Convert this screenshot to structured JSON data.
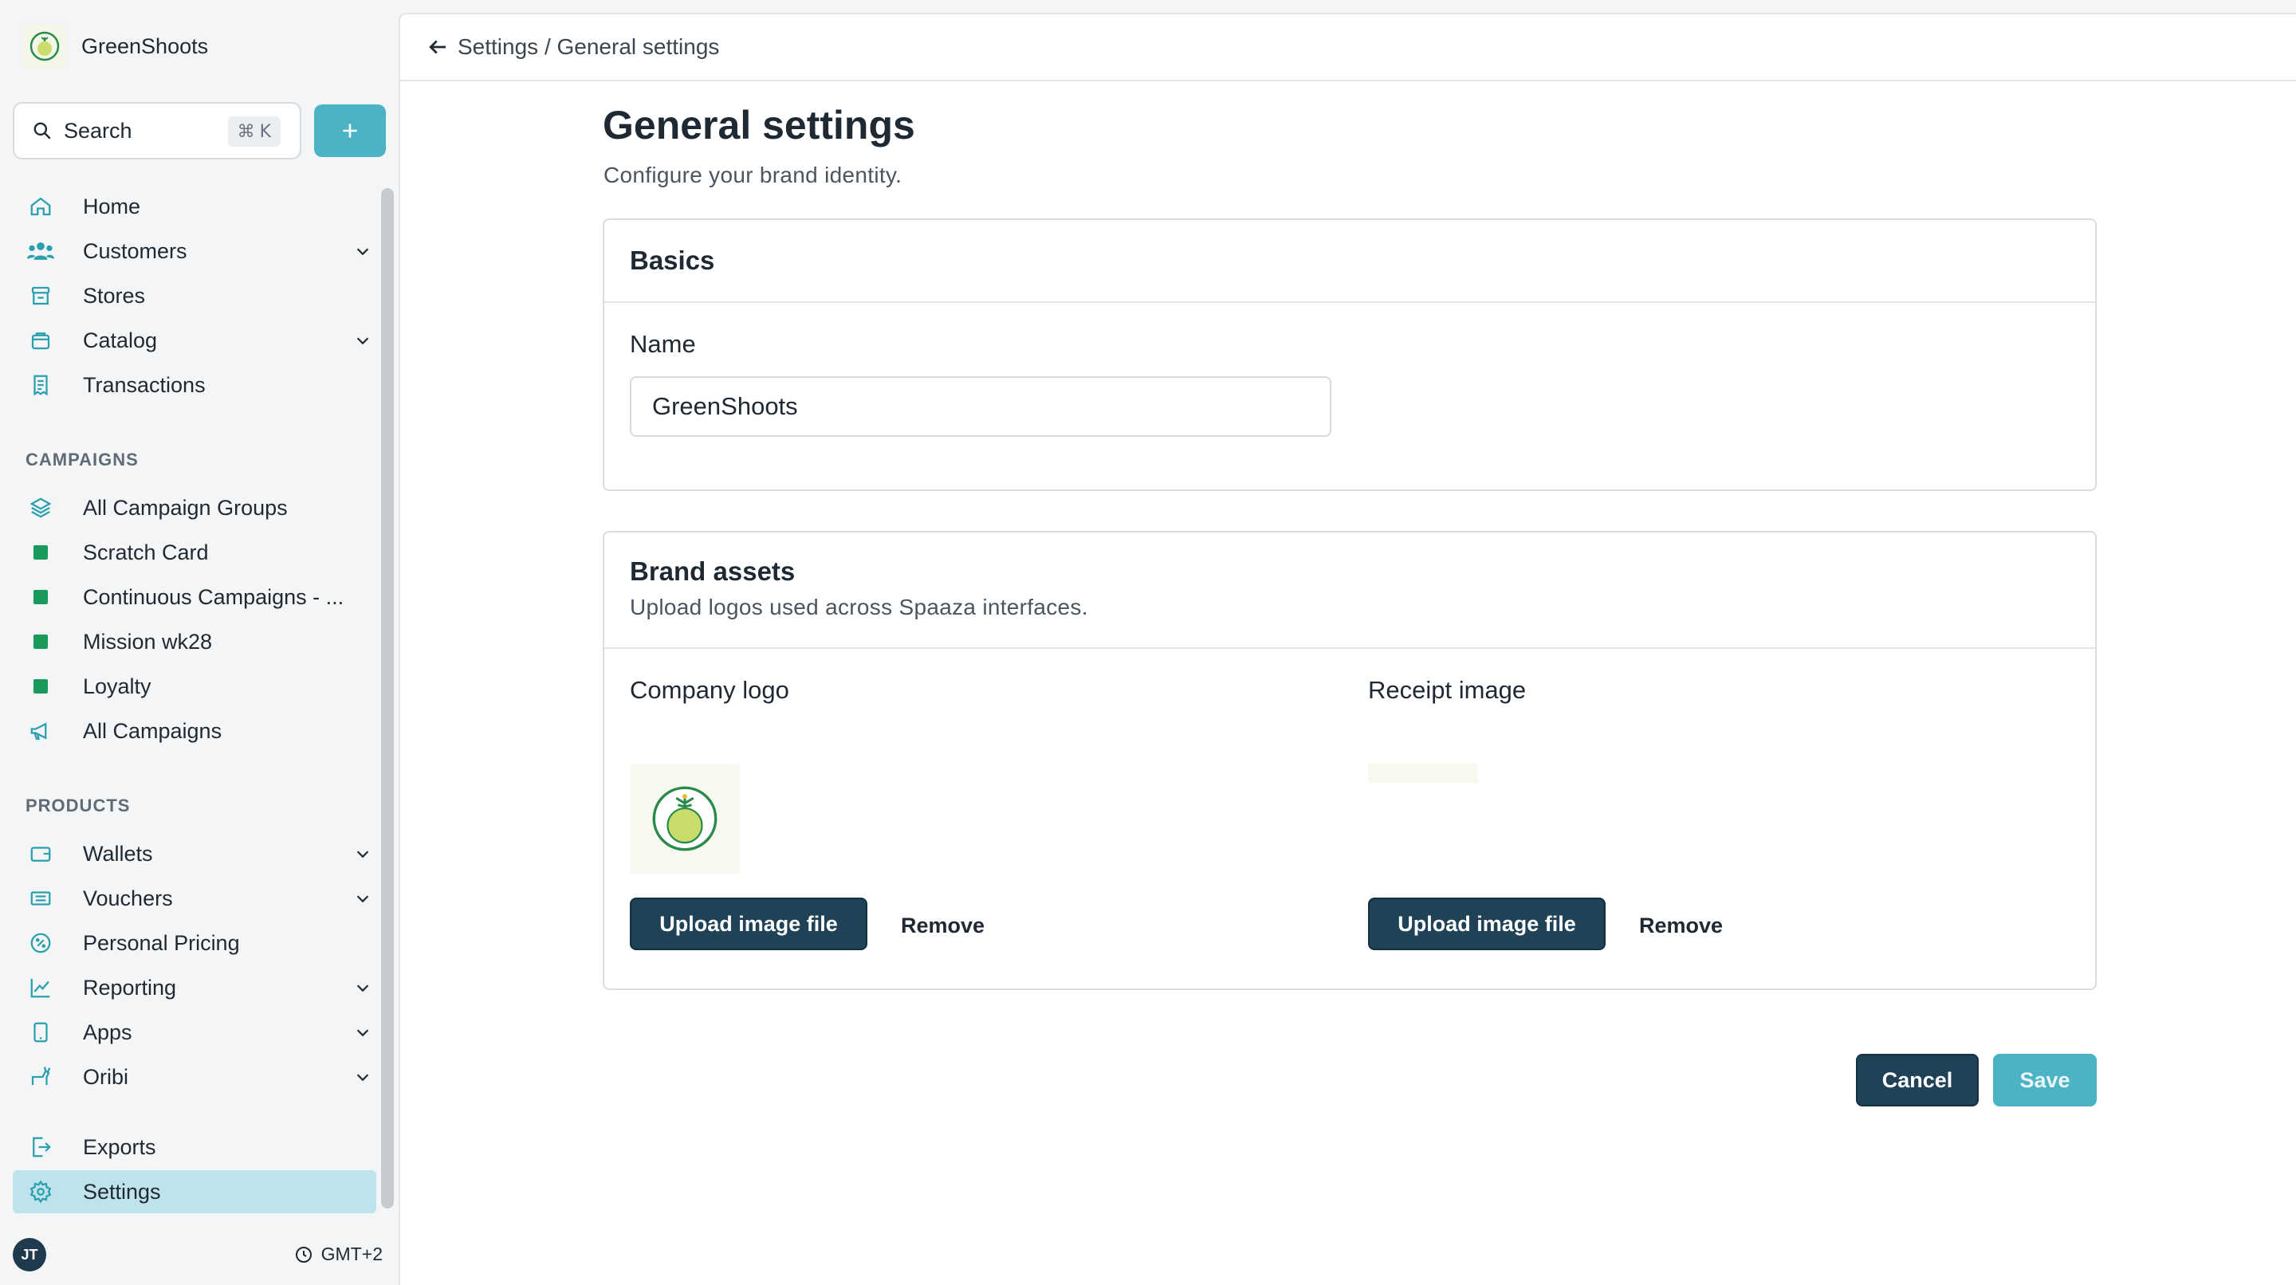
{
  "sidebar": {
    "brand_name": "GreenShoots",
    "search": {
      "label": "Search",
      "shortcut_symbol": "⌘",
      "shortcut_key": "K"
    },
    "main_items": [
      {
        "label": "Home",
        "icon": "home-icon"
      },
      {
        "label": "Customers",
        "icon": "users-icon",
        "expandable": true
      },
      {
        "label": "Stores",
        "icon": "store-icon"
      },
      {
        "label": "Catalog",
        "icon": "bag-icon",
        "expandable": true
      },
      {
        "label": "Transactions",
        "icon": "receipt-icon"
      }
    ],
    "campaigns_heading": "CAMPAIGNS",
    "campaign_items": [
      {
        "label": "All Campaign Groups",
        "icon": "layers-icon"
      },
      {
        "label": "Scratch Card",
        "icon": "green-square-icon"
      },
      {
        "label": "Continuous Campaigns - ...",
        "icon": "green-square-icon"
      },
      {
        "label": "Mission wk28",
        "icon": "green-square-icon"
      },
      {
        "label": "Loyalty",
        "icon": "green-square-icon"
      },
      {
        "label": "All Campaigns",
        "icon": "megaphone-icon"
      }
    ],
    "products_heading": "PRODUCTS",
    "product_items": [
      {
        "label": "Wallets",
        "icon": "wallet-icon",
        "expandable": true
      },
      {
        "label": "Vouchers",
        "icon": "ticket-icon",
        "expandable": true
      },
      {
        "label": "Personal Pricing",
        "icon": "percent-badge-icon"
      },
      {
        "label": "Reporting",
        "icon": "chart-line-icon",
        "expandable": true
      },
      {
        "label": "Apps",
        "icon": "phone-icon",
        "expandable": true
      },
      {
        "label": "Oribi",
        "icon": "animal-icon",
        "expandable": true
      }
    ],
    "bottom_items": [
      {
        "label": "Exports",
        "icon": "export-icon"
      },
      {
        "label": "Settings",
        "icon": "gear-icon",
        "active": true
      }
    ],
    "user_initials": "JT",
    "timezone": "GMT+2"
  },
  "topbar": {
    "breadcrumb": "Settings / General settings"
  },
  "page": {
    "title": "General settings",
    "subtitle": "Configure your brand identity."
  },
  "basics": {
    "title": "Basics",
    "name_label": "Name",
    "name_value": "GreenShoots"
  },
  "brand_assets": {
    "title": "Brand assets",
    "description": "Upload logos used across Spaaza interfaces.",
    "company_logo_label": "Company logo",
    "receipt_image_label": "Receipt image",
    "upload_label": "Upload image file",
    "remove_label": "Remove"
  },
  "actions": {
    "cancel": "Cancel",
    "save": "Save"
  },
  "colors": {
    "accent": "#4bb3c4",
    "dark_button": "#1f4256",
    "active_nav": "#bfe3ea",
    "campaign_square": "#1a9a5a"
  }
}
